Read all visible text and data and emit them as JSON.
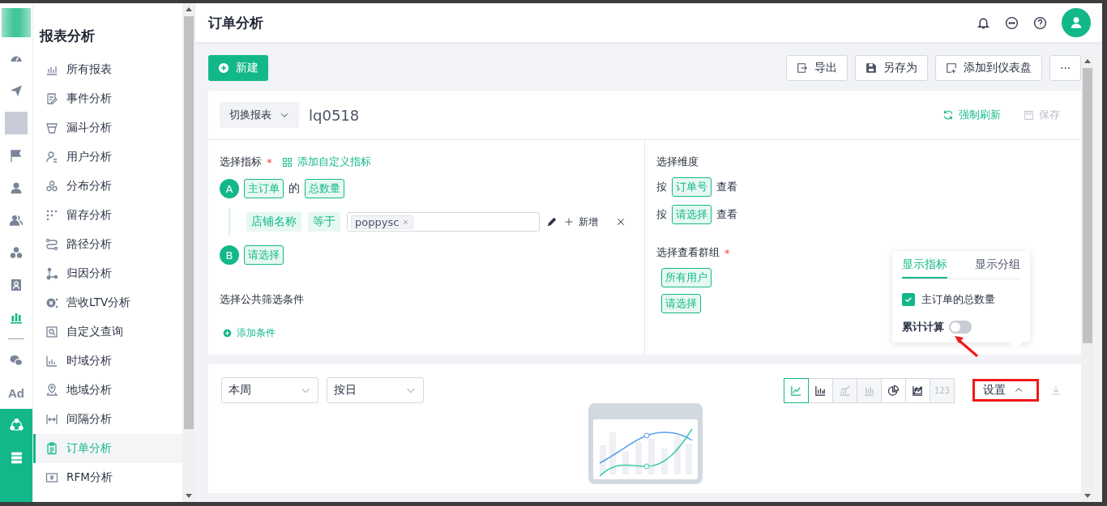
{
  "app_title": "报表分析",
  "rail": [
    {
      "kind": "logo"
    },
    {
      "kind": "icon",
      "selected": false
    },
    {
      "kind": "icon",
      "selected": false
    },
    {
      "kind": "blur"
    },
    {
      "kind": "icon",
      "selected": false
    },
    {
      "kind": "icon",
      "selected": false
    },
    {
      "kind": "icon",
      "selected": false
    },
    {
      "kind": "icon",
      "selected": false
    },
    {
      "kind": "icon",
      "selected": false
    },
    {
      "kind": "icon",
      "selected": true
    },
    {
      "kind": "divider"
    },
    {
      "kind": "icon",
      "selected": false
    },
    {
      "kind": "text",
      "label": "Ad",
      "selected": false
    },
    {
      "kind": "accent"
    },
    {
      "kind": "accent"
    }
  ],
  "nav": [
    {
      "label": "所有报表",
      "selected": false
    },
    {
      "label": "事件分析",
      "selected": false
    },
    {
      "label": "漏斗分析",
      "selected": false
    },
    {
      "label": "用户分析",
      "selected": false
    },
    {
      "label": "分布分析",
      "selected": false
    },
    {
      "label": "留存分析",
      "selected": false
    },
    {
      "label": "路径分析",
      "selected": false
    },
    {
      "label": "归因分析",
      "selected": false
    },
    {
      "label": "营收LTV分析",
      "selected": false
    },
    {
      "label": "自定义查询",
      "selected": false
    },
    {
      "label": "时域分析",
      "selected": false
    },
    {
      "label": "地域分析",
      "selected": false
    },
    {
      "label": "间隔分析",
      "selected": false
    },
    {
      "label": "订单分析",
      "selected": true
    },
    {
      "label": "RFM分析",
      "selected": false
    }
  ],
  "header": {
    "title": "订单分析"
  },
  "toolbar": {
    "new_button": "新建",
    "actions": [
      "导出",
      "另存为",
      "添加到仪表盘"
    ],
    "more": "···"
  },
  "report": {
    "switch_label": "切换报表",
    "name": "lq0518",
    "refresh": "强制刷新",
    "save": {
      "label": "保存",
      "disabled": true
    }
  },
  "metrics": {
    "title": "选择指标",
    "required_mark": "*",
    "add_custom": "添加自定义指标",
    "items": [
      {
        "letter": "A",
        "parts": [
          {
            "kind": "tag",
            "text": "主订单"
          },
          {
            "kind": "text",
            "text": "的"
          },
          {
            "kind": "tag",
            "text": "总数量"
          }
        ],
        "filters": [
          {
            "field": "店铺名称",
            "op": "等于",
            "values": [
              "poppysc"
            ],
            "add_label": "新增"
          }
        ]
      },
      {
        "letter": "B",
        "parts": [
          {
            "kind": "tag",
            "text": "请选择"
          }
        ]
      }
    ]
  },
  "public_filter": {
    "title": "选择公共筛选条件",
    "add": "添加条件"
  },
  "dimensions": {
    "title": "选择维度",
    "rows": [
      {
        "prefix": "按",
        "value": "订单号",
        "suffix": "查看"
      },
      {
        "prefix": "按",
        "value": "请选择",
        "suffix": "查看"
      }
    ]
  },
  "groups": {
    "title": "选择查看群组",
    "required_mark": "*",
    "items": [
      "所有用户",
      "请选择"
    ]
  },
  "chart_controls": {
    "selects": [
      "本周",
      "按日"
    ],
    "types": [
      {
        "kind": "line",
        "selected": true,
        "disabled": false
      },
      {
        "kind": "bar",
        "selected": false,
        "disabled": false
      },
      {
        "kind": "trend",
        "selected": false,
        "disabled": true
      },
      {
        "kind": "stacked",
        "selected": false,
        "disabled": true
      },
      {
        "kind": "pie",
        "selected": false,
        "disabled": false
      },
      {
        "kind": "area",
        "selected": false,
        "disabled": false
      },
      {
        "kind": "number",
        "label": "123",
        "selected": false,
        "disabled": true
      }
    ],
    "settings": {
      "label": "设置",
      "expanded": true
    }
  },
  "popover": {
    "tabs": [
      {
        "label": "显示指标",
        "selected": true
      },
      {
        "label": "显示分组",
        "selected": false
      }
    ],
    "checks": [
      {
        "label": "主订单的总数量",
        "checked": true
      }
    ],
    "toggle": {
      "label": "累计计算",
      "on": false
    }
  }
}
